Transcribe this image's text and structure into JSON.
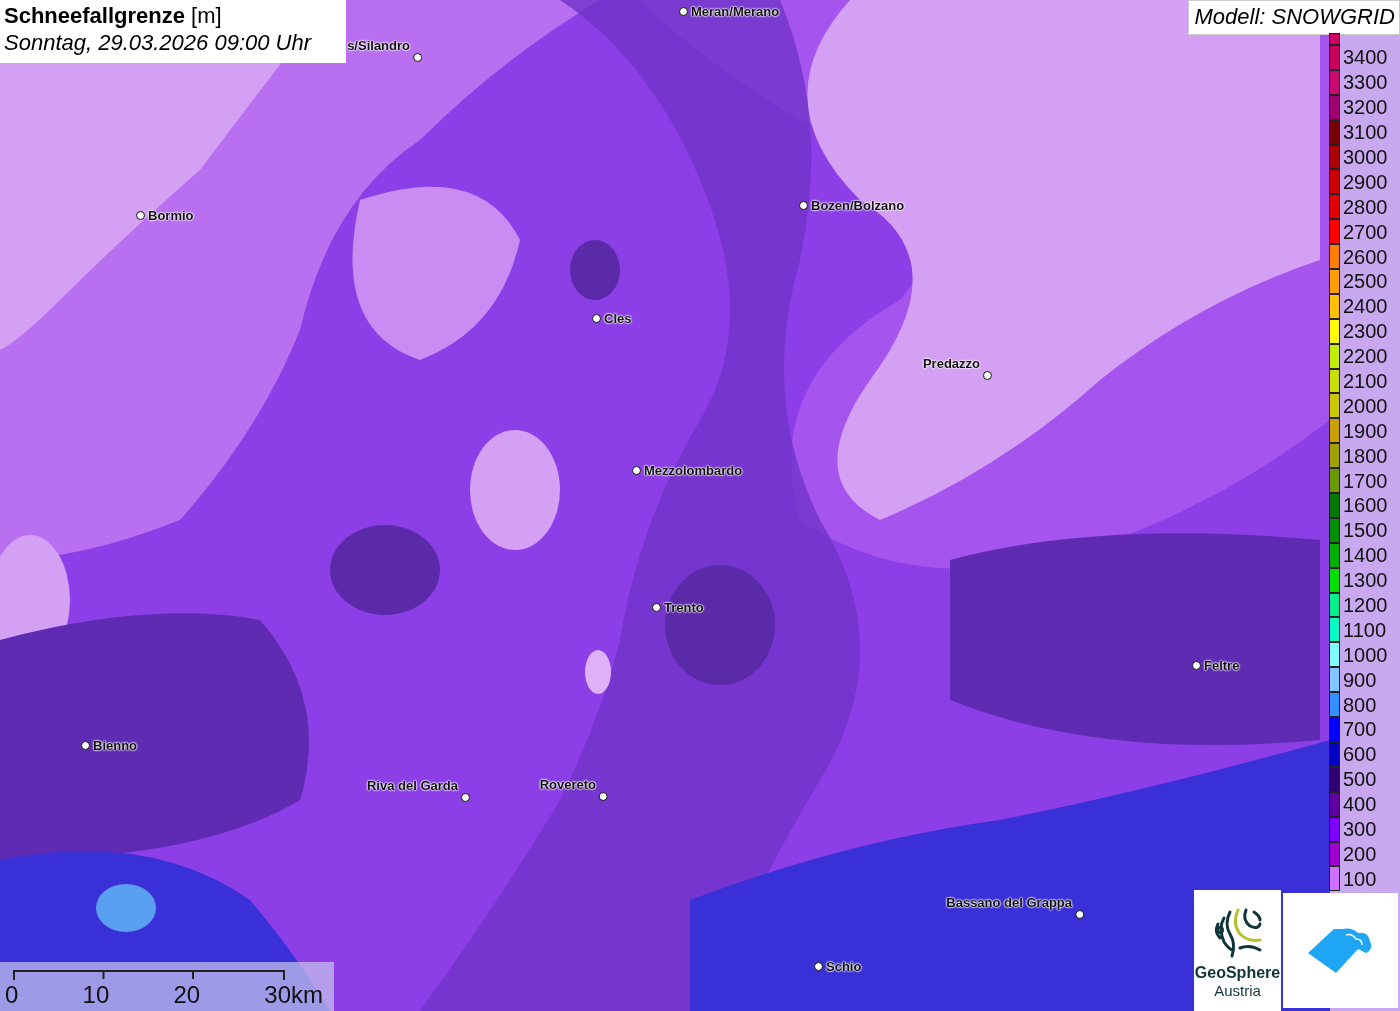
{
  "title": "**Schneefallgrenze** [m]",
  "subtitle": "Sonntag, 29.03.2026 09:00 Uhr",
  "model": "Modell: SNOWGRID",
  "cities": [
    {
      "name": "Meran/Merano"
    },
    {
      "name": "s/Silandro"
    },
    {
      "name": "Bormio"
    },
    {
      "name": "Bozen/Bolzano"
    },
    {
      "name": "Cles"
    },
    {
      "name": "Predazzo"
    },
    {
      "name": "Mezzolombardo"
    },
    {
      "name": "Trento"
    },
    {
      "name": "Feltre"
    },
    {
      "name": "Bienno"
    },
    {
      "name": "Riva del Garda"
    },
    {
      "name": "Rovereto"
    },
    {
      "name": "Bassano del Grappa"
    },
    {
      "name": "Schio"
    }
  ],
  "legend": [
    {
      "label": "3400",
      "color": "#c8005a"
    },
    {
      "label": "3300",
      "color": "#c80a6e"
    },
    {
      "label": "3200",
      "color": "#a0006e"
    },
    {
      "label": "3100",
      "color": "#780000"
    },
    {
      "label": "3000",
      "color": "#aa0000"
    },
    {
      "label": "2900",
      "color": "#c80000"
    },
    {
      "label": "2800",
      "color": "#e00000"
    },
    {
      "label": "2700",
      "color": "#ff0000"
    },
    {
      "label": "2600",
      "color": "#ff8000"
    },
    {
      "label": "2500",
      "color": "#ffa000"
    },
    {
      "label": "2400",
      "color": "#ffc000"
    },
    {
      "label": "2300",
      "color": "#ffff00"
    },
    {
      "label": "2200",
      "color": "#c0f000"
    },
    {
      "label": "2100",
      "color": "#c8e000"
    },
    {
      "label": "2000",
      "color": "#c8c800"
    },
    {
      "label": "1900",
      "color": "#c8a000"
    },
    {
      "label": "1800",
      "color": "#a0a000"
    },
    {
      "label": "1700",
      "color": "#6a9a00"
    },
    {
      "label": "1600",
      "color": "#007800"
    },
    {
      "label": "1500",
      "color": "#009000"
    },
    {
      "label": "1400",
      "color": "#00b000"
    },
    {
      "label": "1300",
      "color": "#00e000"
    },
    {
      "label": "1200",
      "color": "#00f08a"
    },
    {
      "label": "1100",
      "color": "#00ffc0"
    },
    {
      "label": "1000",
      "color": "#80ffff"
    },
    {
      "label": "900",
      "color": "#80c8ff"
    },
    {
      "label": "800",
      "color": "#3090ff"
    },
    {
      "label": "700",
      "color": "#0000ff"
    },
    {
      "label": "600",
      "color": "#0000c0"
    },
    {
      "label": "500",
      "color": "#300070"
    },
    {
      "label": "400",
      "color": "#6000a0"
    },
    {
      "label": "300",
      "color": "#8000ff"
    },
    {
      "label": "200",
      "color": "#a000d0"
    },
    {
      "label": "100",
      "color": "#d070ff"
    }
  ],
  "scale": [
    "0",
    "10",
    "20",
    "30km"
  ],
  "logo": {
    "name": "GeoSphere",
    "sub": "Austria"
  }
}
